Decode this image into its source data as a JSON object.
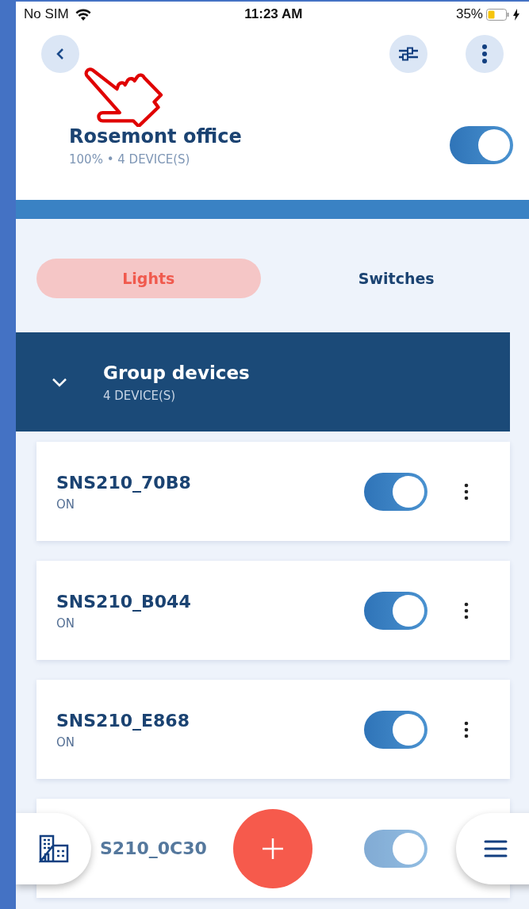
{
  "status_bar": {
    "carrier": "No SIM",
    "time": "11:23 AM",
    "battery": "35%"
  },
  "header": {
    "title": "Rosemont office",
    "subtitle": "100% • 4 DEVICE(S)",
    "on": true
  },
  "tabs": [
    {
      "label": "Lights",
      "selected": true
    },
    {
      "label": "Switches",
      "selected": false
    }
  ],
  "group": {
    "title": "Group devices",
    "subtitle": "4 DEVICE(S)",
    "expanded": true
  },
  "devices": [
    {
      "name": "SNS210_70B8",
      "status": "ON",
      "on": true
    },
    {
      "name": "SNS210_B044",
      "status": "ON",
      "on": true
    },
    {
      "name": "SNS210_E868",
      "status": "ON",
      "on": true
    },
    {
      "name": "S210_0C30",
      "on": true
    }
  ]
}
